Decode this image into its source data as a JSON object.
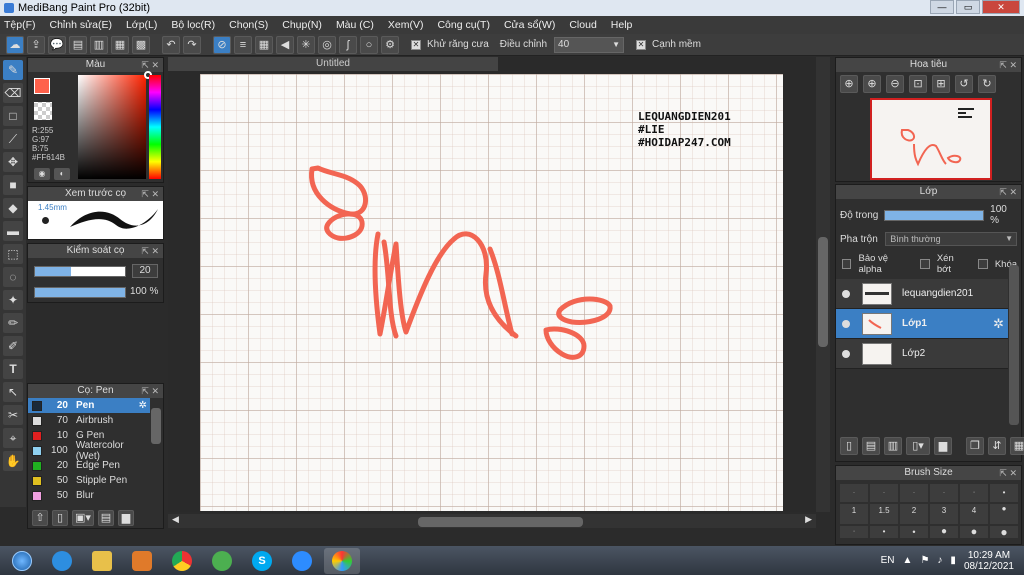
{
  "window": {
    "title": "MediBang Paint Pro (32bit)"
  },
  "menu": [
    "Tệp(F)",
    "Chỉnh sửa(E)",
    "Lớp(L)",
    "Bộ lọc(R)",
    "Chọn(S)",
    "Chụp(N)",
    "Màu (C)",
    "Xem(V)",
    "Công cụ(T)",
    "Cửa sổ(W)",
    "Cloud",
    "Help"
  ],
  "toolbar": {
    "antialias_label": "Khử răng cưa",
    "stabilizer_label": "Điều chỉnh",
    "stabilizer_value": "40",
    "sharp_label": "Cạnh mềm"
  },
  "color_panel": {
    "title": "Màu",
    "r": "R:255",
    "g": "G:97",
    "b": "B:75",
    "hex": "#FF614B",
    "primary": "#ff614b"
  },
  "preview_panel": {
    "title": "Xem trước cọ",
    "size": "1.45mm"
  },
  "brush_control": {
    "title": "Kiểm soát cọ",
    "size": "20",
    "opacity": "100 %"
  },
  "brush_panel": {
    "title": "Cọ: Pen",
    "brushes": [
      {
        "size": "20",
        "name": "Pen",
        "color": "#1b2a3a"
      },
      {
        "size": "70",
        "name": "Airbrush",
        "color": "#dddddd"
      },
      {
        "size": "10",
        "name": "G Pen",
        "color": "#e02020"
      },
      {
        "size": "100",
        "name": "Watercolor (Wet)",
        "color": "#8fd0f0"
      },
      {
        "size": "20",
        "name": "Edge Pen",
        "color": "#20b020"
      },
      {
        "size": "50",
        "name": "Stipple Pen",
        "color": "#e0c020"
      },
      {
        "size": "50",
        "name": "Blur",
        "color": "#f0a0e0"
      }
    ]
  },
  "document": {
    "tab": "Untitled",
    "watermark": [
      "LEQUANGDIEN201",
      "#LIE",
      "#HOIDAP247.COM"
    ],
    "stroke_color": "#f26552"
  },
  "navigator": {
    "title": "Hoa tiêu"
  },
  "layer_panel": {
    "title": "Lớp",
    "opacity_label": "Độ trong",
    "opacity_value": "100 %",
    "blend_label": "Pha trộn",
    "blend_value": "Bình thường",
    "protect_alpha": "Bảo vệ alpha",
    "clip": "Xén bớt",
    "lock": "Khóa",
    "layers": [
      "lequangdien201",
      "Lớp1",
      "Lớp2"
    ]
  },
  "brush_size": {
    "title": "Brush Size",
    "labels": [
      "1",
      "1.5",
      "2",
      "3",
      "4"
    ]
  },
  "taskbar": {
    "lang": "EN",
    "time": "10:29 AM",
    "date": "08/12/2021"
  }
}
